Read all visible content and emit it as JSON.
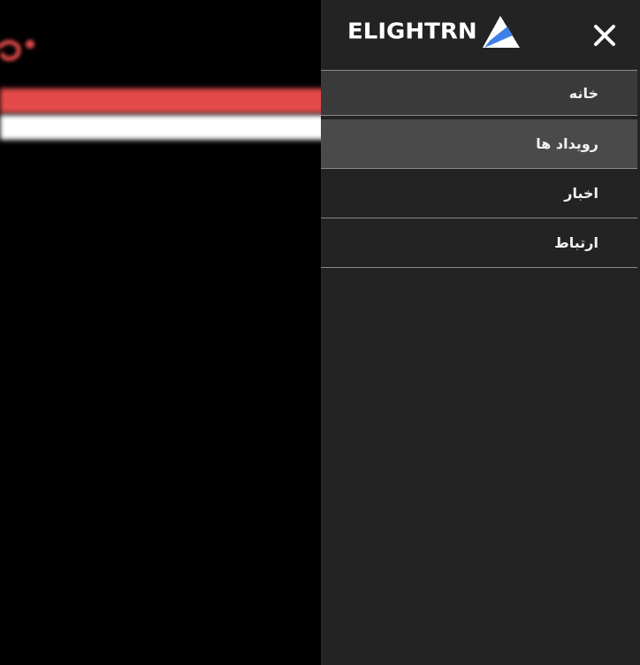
{
  "background": {
    "page_bg": "#000000",
    "banner_red": "#e54a4a",
    "banner_white": "#ffffff"
  },
  "drawer": {
    "bg_color": "#232323",
    "active_color": "#4a4a4a",
    "logo": {
      "text": "ELIGHTRN",
      "mark_icon": "triangle-logo-icon",
      "accent": "#3f7fe6"
    },
    "close_icon": "close-icon",
    "menu": [
      {
        "label": "خانه"
      },
      {
        "label": "رویداد ها",
        "active": true
      },
      {
        "label": "اخبار"
      },
      {
        "label": "ارتباط"
      }
    ]
  }
}
